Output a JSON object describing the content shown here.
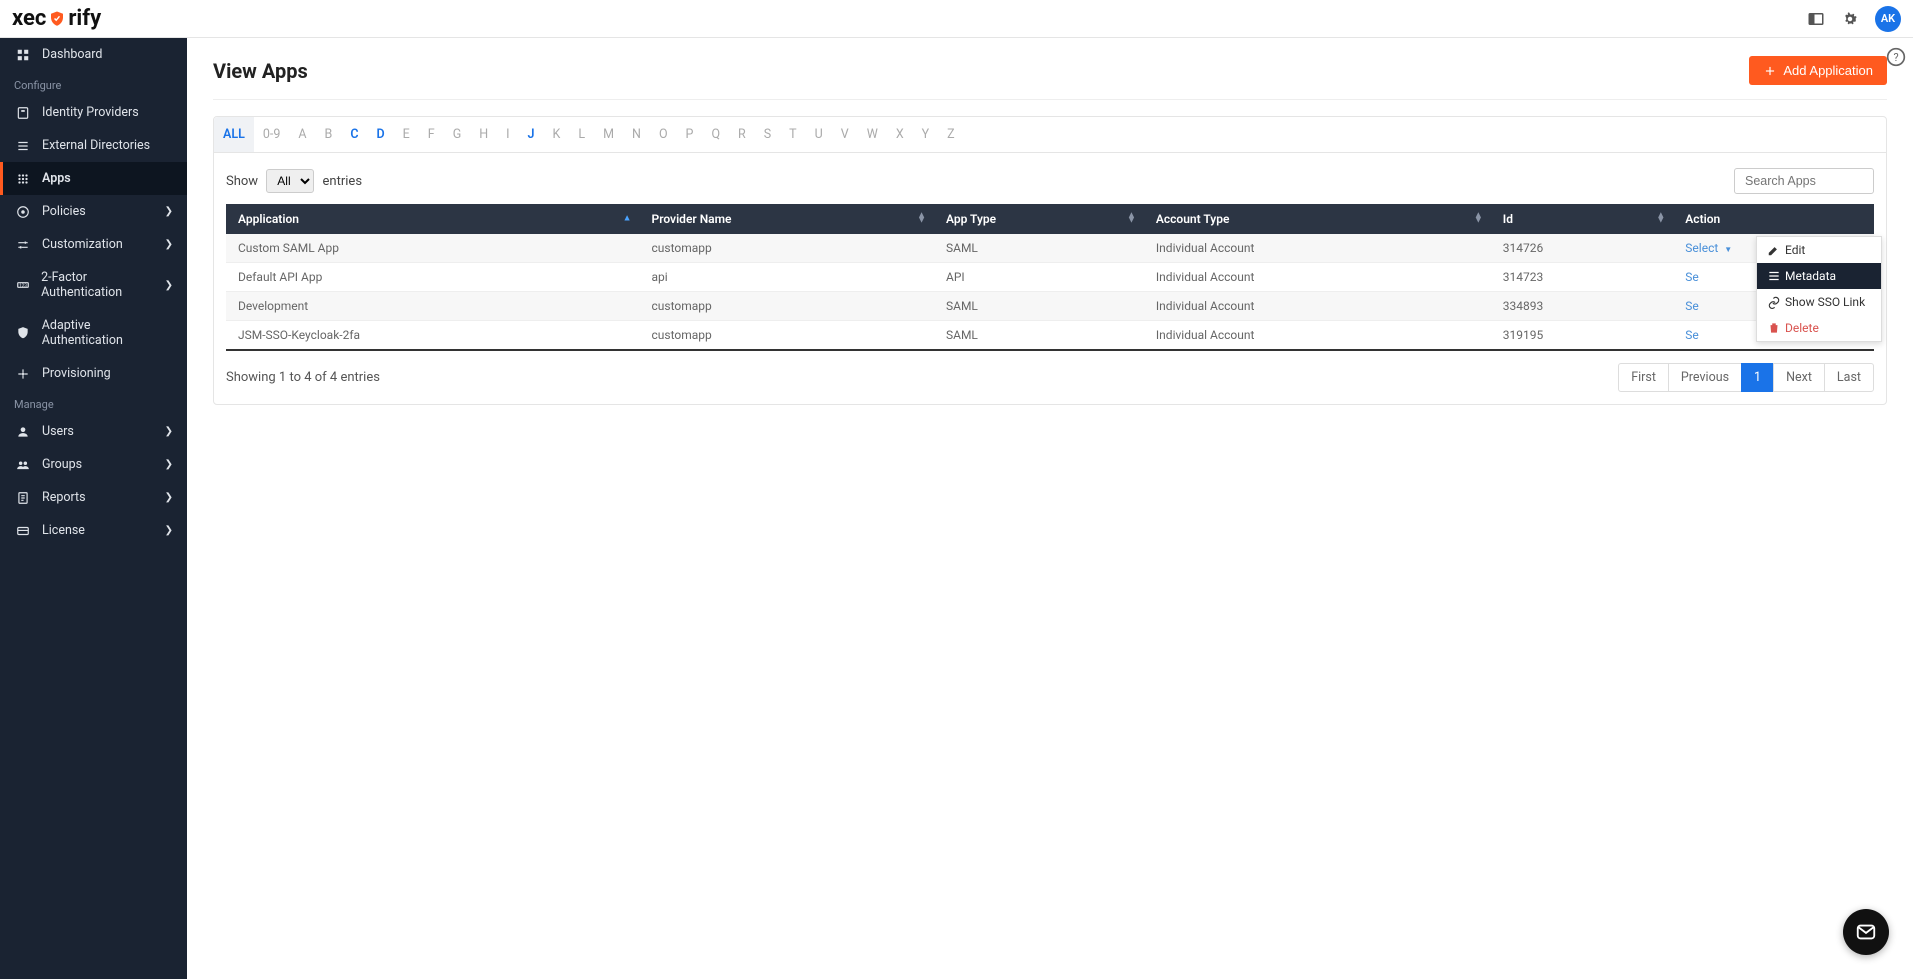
{
  "brand": {
    "name_left": "xec",
    "name_right": "rify"
  },
  "header": {
    "avatar_initials": "AK"
  },
  "sidebar": {
    "section_configure": "Configure",
    "section_manage": "Manage",
    "items_top": [
      {
        "label": "Dashboard",
        "icon": "dashboard",
        "chevron": false
      }
    ],
    "items_configure": [
      {
        "label": "Identity Providers",
        "icon": "idp",
        "chevron": false
      },
      {
        "label": "External Directories",
        "icon": "directories",
        "chevron": false
      },
      {
        "label": "Apps",
        "icon": "apps",
        "chevron": false,
        "active": true
      },
      {
        "label": "Policies",
        "icon": "policies",
        "chevron": true
      },
      {
        "label": "Customization",
        "icon": "customization",
        "chevron": true
      },
      {
        "label": "2-Factor Authentication",
        "icon": "twofa",
        "chevron": true
      },
      {
        "label": "Adaptive Authentication",
        "icon": "adaptive",
        "chevron": false
      },
      {
        "label": "Provisioning",
        "icon": "provisioning",
        "chevron": false
      }
    ],
    "items_manage": [
      {
        "label": "Users",
        "icon": "users",
        "chevron": true
      },
      {
        "label": "Groups",
        "icon": "groups",
        "chevron": true
      },
      {
        "label": "Reports",
        "icon": "reports",
        "chevron": true
      },
      {
        "label": "License",
        "icon": "license",
        "chevron": true
      }
    ]
  },
  "page": {
    "title": "View Apps",
    "add_button": "Add Application"
  },
  "filters": {
    "active": "ALL",
    "highlighted": [
      "C",
      "D",
      "J"
    ],
    "letters": [
      "ALL",
      "0-9",
      "A",
      "B",
      "C",
      "D",
      "E",
      "F",
      "G",
      "H",
      "I",
      "J",
      "K",
      "L",
      "M",
      "N",
      "O",
      "P",
      "Q",
      "R",
      "S",
      "T",
      "U",
      "V",
      "W",
      "X",
      "Y",
      "Z"
    ]
  },
  "table": {
    "show_label_left": "Show",
    "show_label_right": "entries",
    "show_value": "All",
    "search_placeholder": "Search Apps",
    "columns": [
      "Application",
      "Provider Name",
      "App Type",
      "Account Type",
      "Id",
      "Action"
    ],
    "rows": [
      {
        "app": "Custom SAML App",
        "provider": "customapp",
        "type": "SAML",
        "account": "Individual Account",
        "id": "314726",
        "action": "Select"
      },
      {
        "app": "Default API App",
        "provider": "api",
        "type": "API",
        "account": "Individual Account",
        "id": "314723",
        "action": "Se"
      },
      {
        "app": "Development",
        "provider": "customapp",
        "type": "SAML",
        "account": "Individual Account",
        "id": "334893",
        "action": "Se"
      },
      {
        "app": "JSM-SSO-Keycloak-2fa",
        "provider": "customapp",
        "type": "SAML",
        "account": "Individual Account",
        "id": "319195",
        "action": "Se"
      }
    ],
    "info": "Showing 1 to 4 of 4 entries",
    "pager": {
      "first": "First",
      "prev": "Previous",
      "pages": [
        "1"
      ],
      "next": "Next",
      "last": "Last",
      "active": "1"
    }
  },
  "dropdown": {
    "items": [
      {
        "label": "Edit",
        "icon": "edit"
      },
      {
        "label": "Metadata",
        "icon": "metadata",
        "active": true
      },
      {
        "label": "Show SSO Link",
        "icon": "link"
      },
      {
        "label": "Delete",
        "icon": "delete",
        "danger": true
      }
    ]
  }
}
